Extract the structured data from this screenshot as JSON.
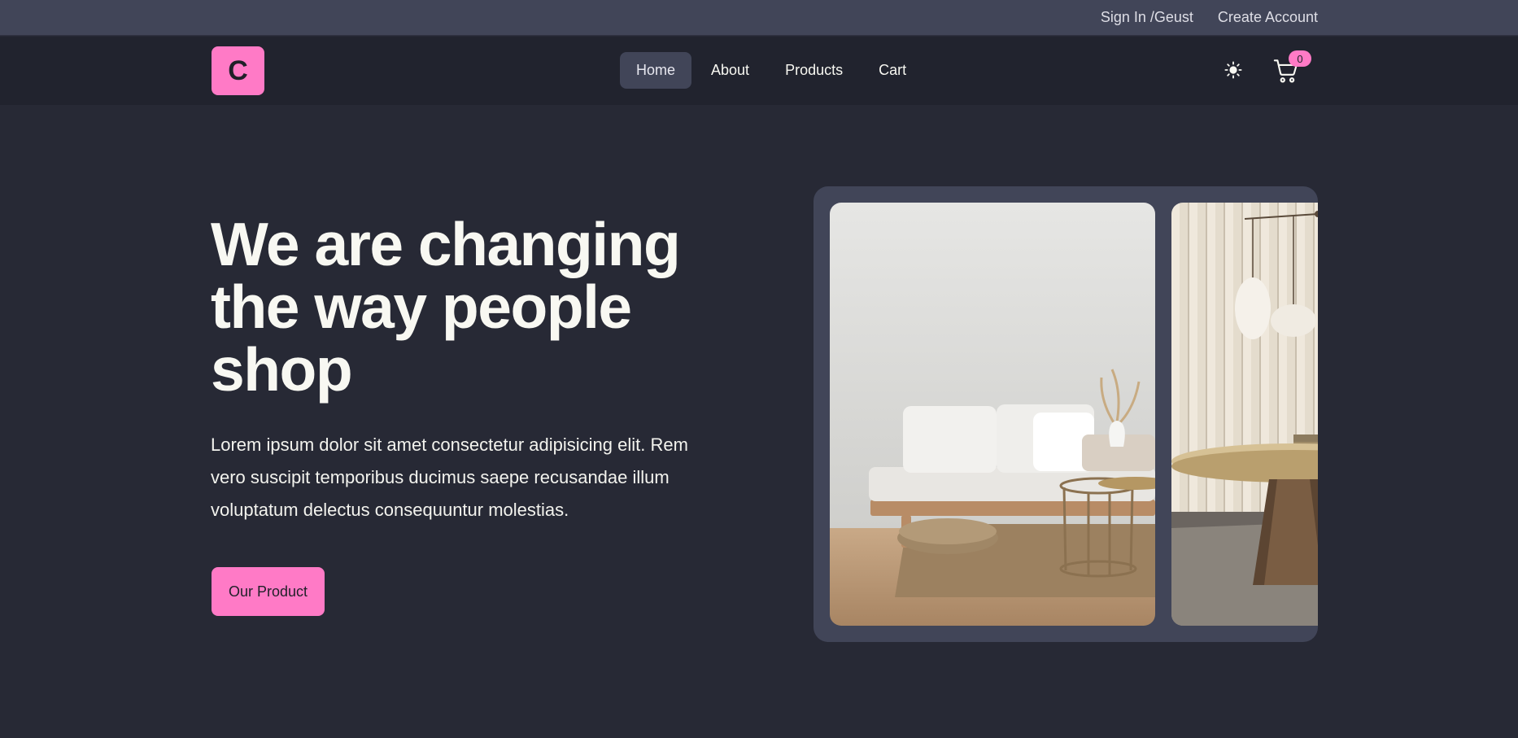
{
  "topbar": {
    "sign_in_label": "Sign In /Geust",
    "create_account_label": "Create Account"
  },
  "navbar": {
    "logo_letter": "C",
    "links": [
      {
        "label": "Home",
        "active": true
      },
      {
        "label": "About",
        "active": false
      },
      {
        "label": "Products",
        "active": false
      },
      {
        "label": "Cart",
        "active": false
      }
    ],
    "theme_icon": "sun-icon",
    "cart_icon": "cart-icon",
    "cart_count": "0"
  },
  "hero": {
    "title_line1": "We are changing",
    "title_line2": "the way people",
    "title_line3": "shop",
    "text_line1": "Lorem ipsum dolor sit amet consectetur adipisicing elit. Rem",
    "text_line2": "vero suscipit temporibus ducimus saepe recusandae illum",
    "text_line3": "voluptatum delectus consequuntur molestias.",
    "cta_label": "Our Product"
  },
  "colors": {
    "background": "#272935",
    "navbar": "#21232e",
    "topbar": "#414558",
    "accent": "#ff7ac6"
  }
}
